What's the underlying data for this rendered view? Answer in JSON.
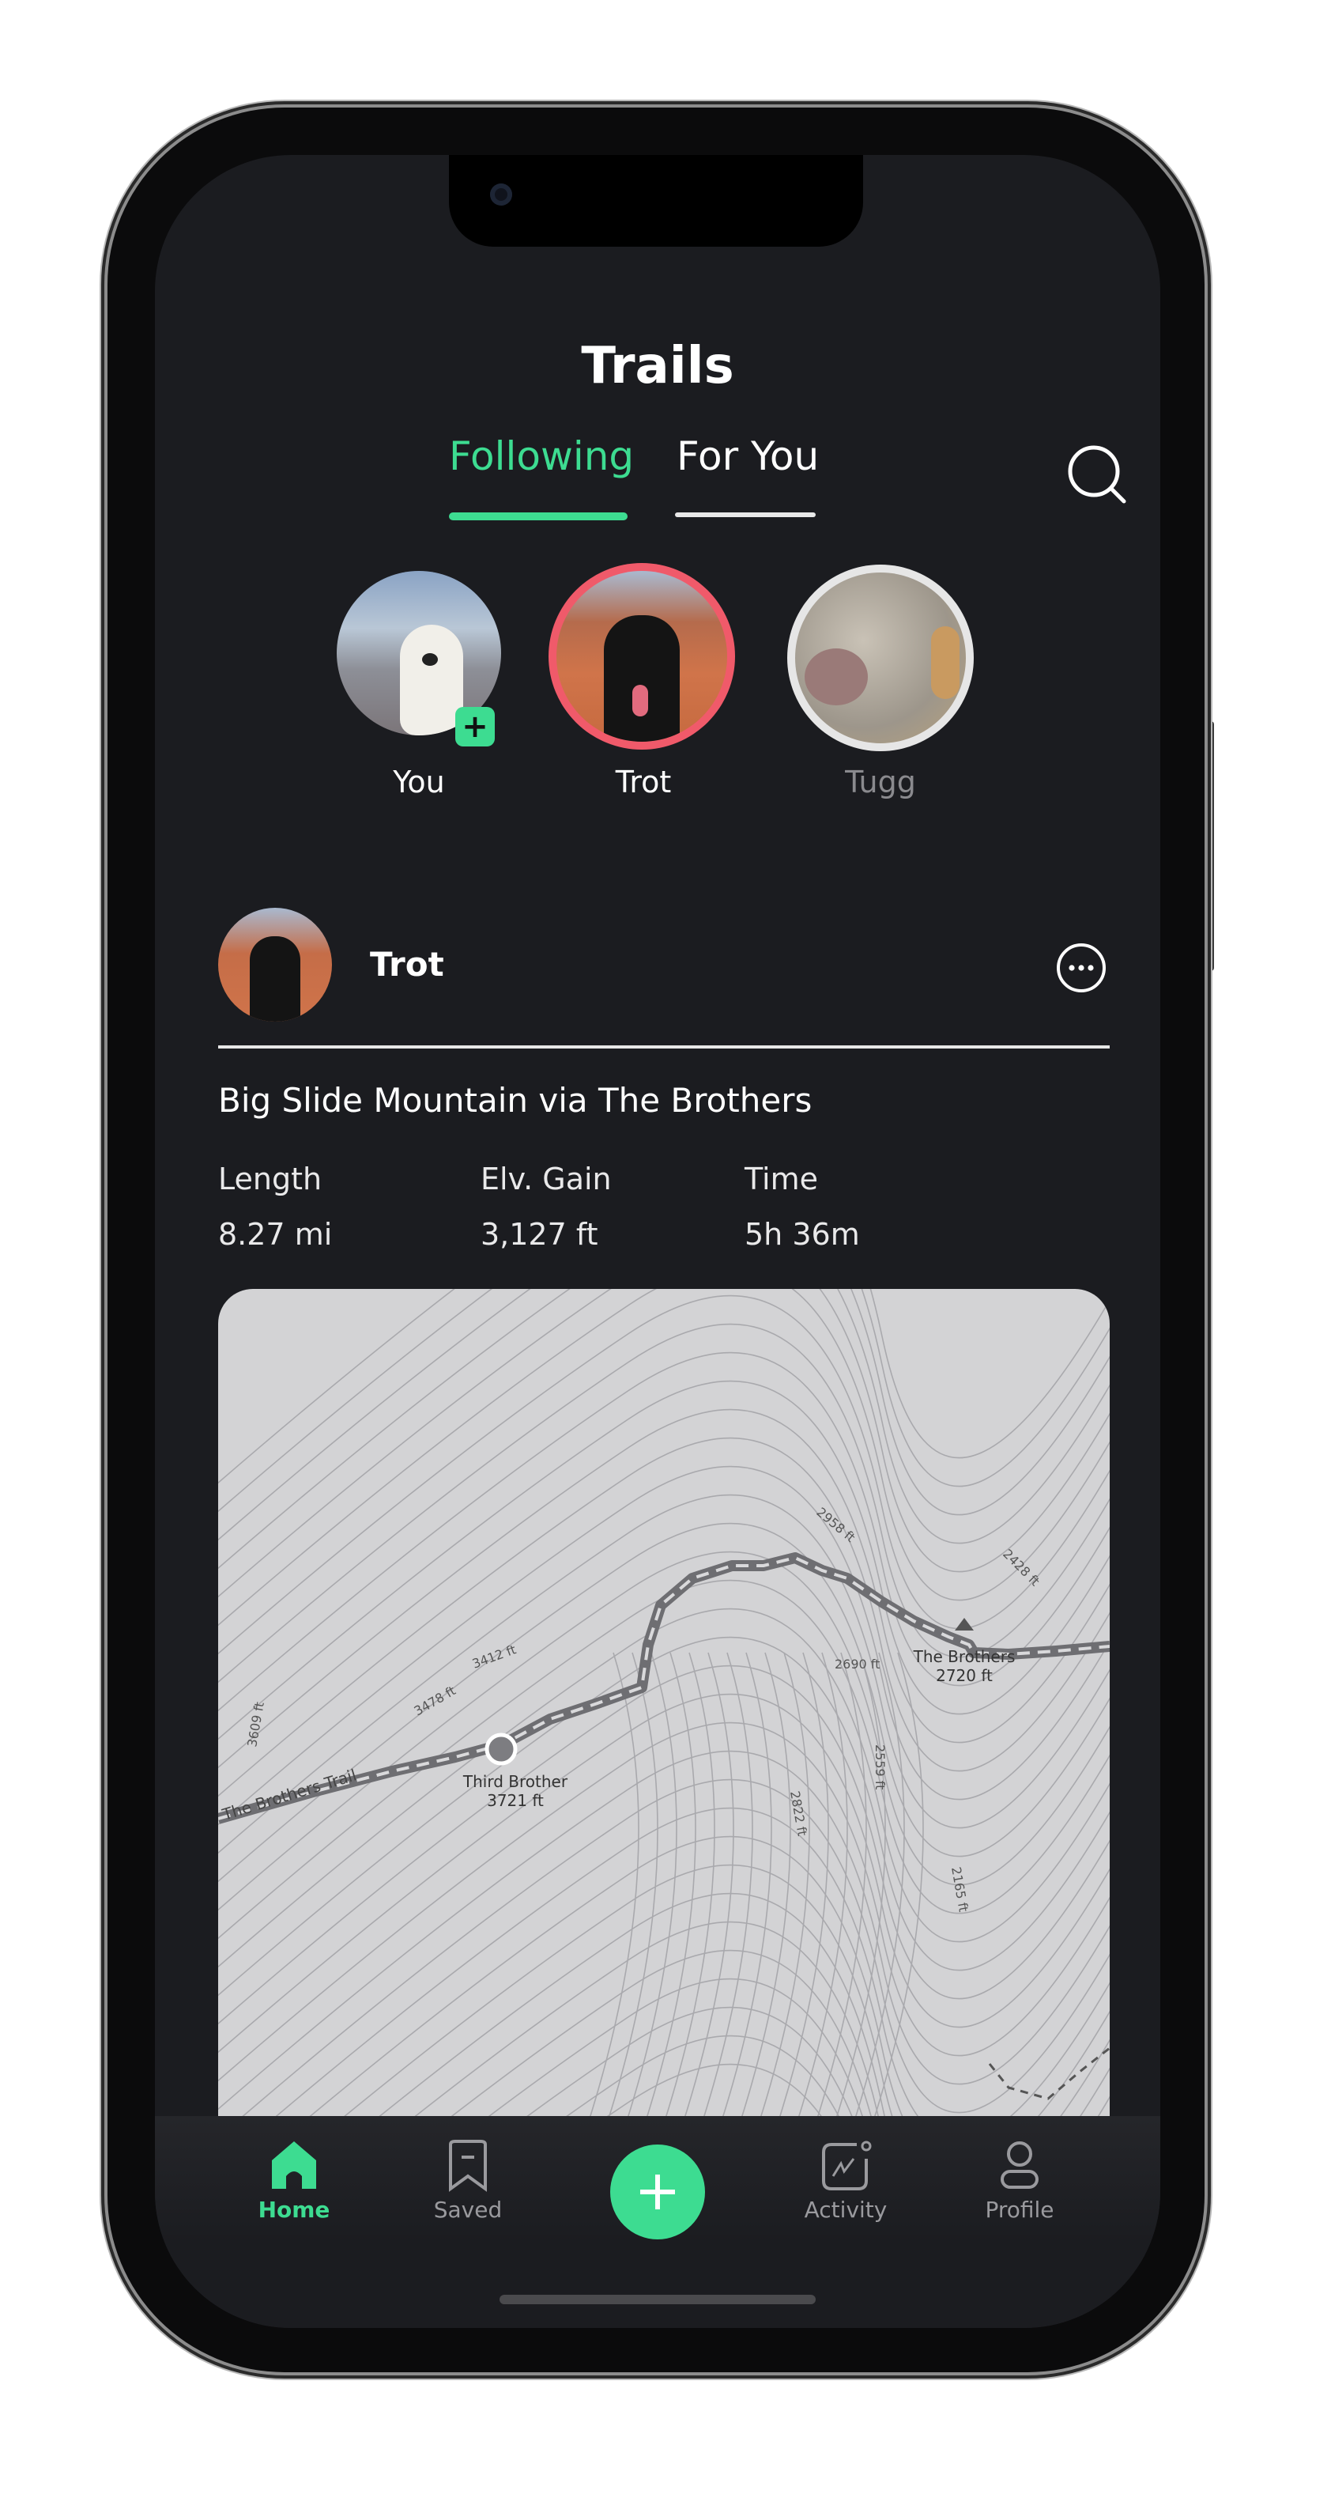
{
  "header": {
    "title": "Trails",
    "search_icon": "search-icon"
  },
  "tabs": [
    {
      "label": "Following",
      "active": true
    },
    {
      "label": "For You",
      "active": false
    }
  ],
  "stories": [
    {
      "name": "You",
      "badge": "+",
      "ring": "none"
    },
    {
      "name": "Trot",
      "ring": "#f05a6a"
    },
    {
      "name": "Tugg",
      "ring": "#e6e6e6",
      "seen": true
    }
  ],
  "post": {
    "author": "Trot",
    "more_icon": "more-horizontal-icon",
    "trail_name": "Big Slide Mountain via The Brothers",
    "stats": [
      {
        "label": "Length",
        "value": "8.27 mi"
      },
      {
        "label": "Elv. Gain",
        "value": "3,127 ft"
      },
      {
        "label": "Time",
        "value": "5h 36m"
      }
    ],
    "map": {
      "trail_label": "The Brothers Trail",
      "peaks": [
        {
          "name": "Third Brother",
          "elevation": "3721 ft"
        },
        {
          "name": "The Brothers",
          "elevation": "2720 ft"
        }
      ],
      "contour_labels": [
        "3412 ft",
        "3478 ft",
        "3609 ft",
        "2958 ft",
        "2428 ft",
        "2690 ft",
        "2559 ft",
        "2822 ft",
        "2165 ft"
      ]
    }
  },
  "nav": {
    "items": [
      {
        "label": "Home",
        "icon": "home-icon",
        "active": true
      },
      {
        "label": "Saved",
        "icon": "bookmark-icon"
      },
      {
        "label": "",
        "icon": "plus-icon"
      },
      {
        "label": "Activity",
        "icon": "activity-icon"
      },
      {
        "label": "Profile",
        "icon": "profile-icon"
      }
    ]
  },
  "colors": {
    "accent": "#3ddc91",
    "background": "#1b1c20",
    "story_ring": "#f05a6a"
  }
}
